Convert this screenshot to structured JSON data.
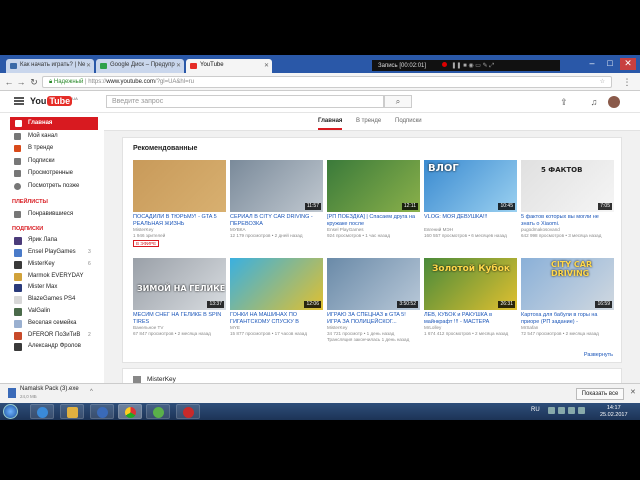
{
  "browser": {
    "tabs": [
      {
        "title": "Как начать играть? | Ne",
        "favicon_color": "#3b6aa8"
      },
      {
        "title": "Google Диск – Предупр",
        "favicon_color": "#2da14b"
      },
      {
        "title": "YouTube",
        "favicon_color": "#e52d27"
      }
    ],
    "recorder_text": "Запись [00:02:01]",
    "url_secure": "Надежный",
    "url_prefix": "https://",
    "url_host": "www.youtube.com",
    "url_path": "/?gl=UA&hl=ru"
  },
  "youtube": {
    "logo_text": "You",
    "logo_tube": "Tube",
    "logo_region": "UA",
    "search_placeholder": "Введите запрос",
    "content_tabs": [
      "Главная",
      "В тренде",
      "Подписки"
    ]
  },
  "sidebar": {
    "items": [
      {
        "label": "Главная",
        "icon": "home-icon"
      },
      {
        "label": "Мой канал",
        "icon": "user-icon"
      },
      {
        "label": "В тренде",
        "icon": "flame-icon"
      },
      {
        "label": "Подписки",
        "icon": "subscriptions-icon"
      },
      {
        "label": "Просмотренные",
        "icon": "history-icon"
      },
      {
        "label": "Посмотреть позже",
        "icon": "clock-icon"
      }
    ],
    "playlists_heading": "ПЛЕЙЛИСТЫ",
    "playlists": [
      {
        "label": "Понравившиеся",
        "icon": "thumbs-up-icon"
      }
    ],
    "subs_heading": "ПОДПИСКИ",
    "subs": [
      {
        "label": "Ярик Лапа",
        "count": "",
        "color": "#4b3b7a"
      },
      {
        "label": "Ensel PlayGames",
        "count": "3",
        "color": "#4a7bc9"
      },
      {
        "label": "MisterKey",
        "count": "6",
        "color": "#3a3a3a"
      },
      {
        "label": "Marmok EVERYDAY",
        "count": "",
        "color": "#d1a23a"
      },
      {
        "label": "Mister Max",
        "count": "",
        "color": "#2a3a7a"
      },
      {
        "label": "BlazeGames PS4",
        "count": "",
        "color": "#d8d8d8"
      },
      {
        "label": "ValGalin",
        "count": "",
        "color": "#4a6a4a"
      },
      {
        "label": "Веселая семейка",
        "count": "",
        "color": "#9ab0d0"
      },
      {
        "label": "DFEROR ПоЗиТиВ",
        "count": "2",
        "color": "#c84a2a"
      },
      {
        "label": "Александр Фролов",
        "count": "",
        "color": "#3a3a3a"
      }
    ]
  },
  "feed": {
    "section_title": "Рекомендованные",
    "expand_label": "Развернуть",
    "next_channel": "MisterKey",
    "videos": [
      {
        "title": "ПОСАДИЛИ В ТЮРЬМУ! - GTA 5 РЕАЛЬНАЯ ЖИЗНЬ",
        "channel": "MisterKey",
        "views": "1 946 зрителей",
        "age": "",
        "duration": "",
        "badge": "В ЭФИРЕ",
        "thumb_colors": [
          "#c89a5a",
          "#d8b070"
        ],
        "thumb_text": ""
      },
      {
        "title": "СЕРИАЛ В CITY CAR DRIVING - ПЕРЕВОЗКА",
        "channel": "МУВКА",
        "views": "12 179 просмотров",
        "age": "2 дней назад",
        "duration": "11:57",
        "badge": "",
        "thumb_colors": [
          "#7a8a9a",
          "#c0c8d0"
        ],
        "thumb_text": ""
      },
      {
        "title": "[РП ПОЕЗДКА] | Спасаем друга на кружаке после",
        "channel": "Ensel PlayGames",
        "views": "924 просмотров",
        "age": "1 час назад",
        "duration": "12:11",
        "badge": "",
        "thumb_colors": [
          "#3a7a3a",
          "#8ab04a"
        ],
        "thumb_text": ""
      },
      {
        "title": "VLOG: МОЯ ДЕВУШКА!!!",
        "channel": "Евгений МЭН",
        "views": "160 557 просмотров",
        "age": "6 месяцев назад",
        "duration": "10:45",
        "badge": "",
        "thumb_colors": [
          "#3a8ad0",
          "#9ad0f0"
        ],
        "thumb_text": "ВЛОГ"
      },
      {
        "title": "5 фактов которых вы могли не знать о Xiaomi.",
        "channel": "pugodmakosovand",
        "views": "642 998 просмотров",
        "age": "3 месяца назад",
        "duration": "7:05",
        "badge": "",
        "thumb_colors": [
          "#e0e0e0",
          "#f5f5f5"
        ],
        "thumb_text": "5 ФАКТОВ"
      },
      {
        "title": "МЕСИМ СНЕГ НА ГЕЛИКЕ В SPIN TIRES",
        "channel": "Ванельное TV",
        "views": "67 847 просмотров",
        "age": "2 месяца назад",
        "duration": "13:37",
        "badge": "",
        "thumb_colors": [
          "#9aa0a8",
          "#d8dce0"
        ],
        "thumb_text": "ЗИМОЙ НА ГЕЛИКЕ"
      },
      {
        "title": "ГОНКИ НА МАШИНАХ ПО ГИГАНТСКОМУ СПУСКУ В",
        "channel": "MYE",
        "views": "15 877 просмотров",
        "age": "17 часов назад",
        "duration": "12:06",
        "badge": "",
        "thumb_colors": [
          "#3ab0e0",
          "#e0c030"
        ],
        "thumb_text": ""
      },
      {
        "title": "ИГРАЮ ЗА СПЕЦНАЗ в GTA 5! ИГРА ЗА ПОЛИЦЕЙСКОГ...",
        "channel": "MisterKey",
        "views": "34 721 просмотр",
        "age": "1 день назад",
        "duration": "3:50:52",
        "badge": "",
        "thumb_colors": [
          "#6a8aa8",
          "#b8c8d8"
        ],
        "thumb_text": ""
      },
      {
        "title": "ЛЕВ, КУБОК и РАКУШКА в майнкрафт !!! - МАСТЕРА",
        "channel": "MrLolley",
        "views": "1 674 412 просмотров",
        "age": "2 месяца назад",
        "duration": "26:31",
        "badge": "",
        "thumb_colors": [
          "#4a8a3a",
          "#e0c030"
        ],
        "thumb_text": "Золотой Кубок"
      },
      {
        "title": "Картоха для бабули в горы на приоре (РП задание) -",
        "channel": "MrSafan",
        "views": "72 547 просмотров",
        "age": "2 месяца назад",
        "duration": "16:59",
        "badge": "",
        "thumb_colors": [
          "#8ab0d8",
          "#d0d8e0"
        ],
        "thumb_text": "CITY CAR DRIVING"
      }
    ],
    "live_note": "Трансляция закончилась 1 день назад"
  },
  "download": {
    "file_name": "Namalsk Pack (3).exe",
    "file_size": "24,0 МБ",
    "show_all": "Показать все"
  },
  "taskbar": {
    "lang": "RU",
    "time": "14:17",
    "date": "25.02.2017"
  }
}
